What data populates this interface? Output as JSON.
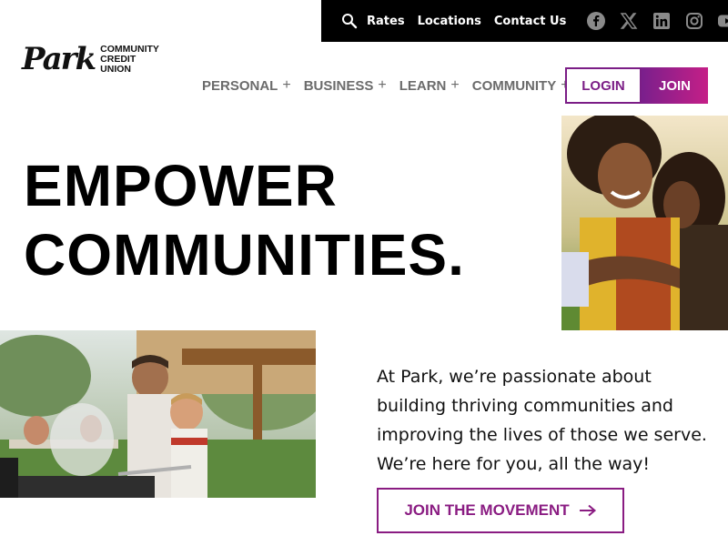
{
  "utility": {
    "links": [
      "Rates",
      "Locations",
      "Contact Us"
    ],
    "search_icon": "search-icon",
    "social_icons": [
      "facebook-icon",
      "x-icon",
      "linkedin-icon",
      "instagram-icon",
      "youtube-icon"
    ]
  },
  "logo": {
    "script": "Park",
    "line1": "COMMUNITY",
    "line2": "CREDIT UNION"
  },
  "nav": {
    "items": [
      {
        "label": "PERSONAL"
      },
      {
        "label": "BUSINESS"
      },
      {
        "label": "LEARN"
      },
      {
        "label": "COMMUNITY"
      }
    ],
    "login_label": "LOGIN",
    "join_label": "JOIN"
  },
  "hero": {
    "line1": "EMPOWER",
    "line2": "COMMUNITIES."
  },
  "intro": {
    "text": "At Park, we’re passionate about building thriving communities and improving the lives of those we serve. We’re here for you, all the way!"
  },
  "cta": {
    "label": "JOIN THE MOVEMENT"
  },
  "colors": {
    "brand_purple": "#7b1d86",
    "brand_magenta": "#c51f87",
    "utility_bg": "#000000",
    "nav_gray": "#6b6b6b"
  }
}
